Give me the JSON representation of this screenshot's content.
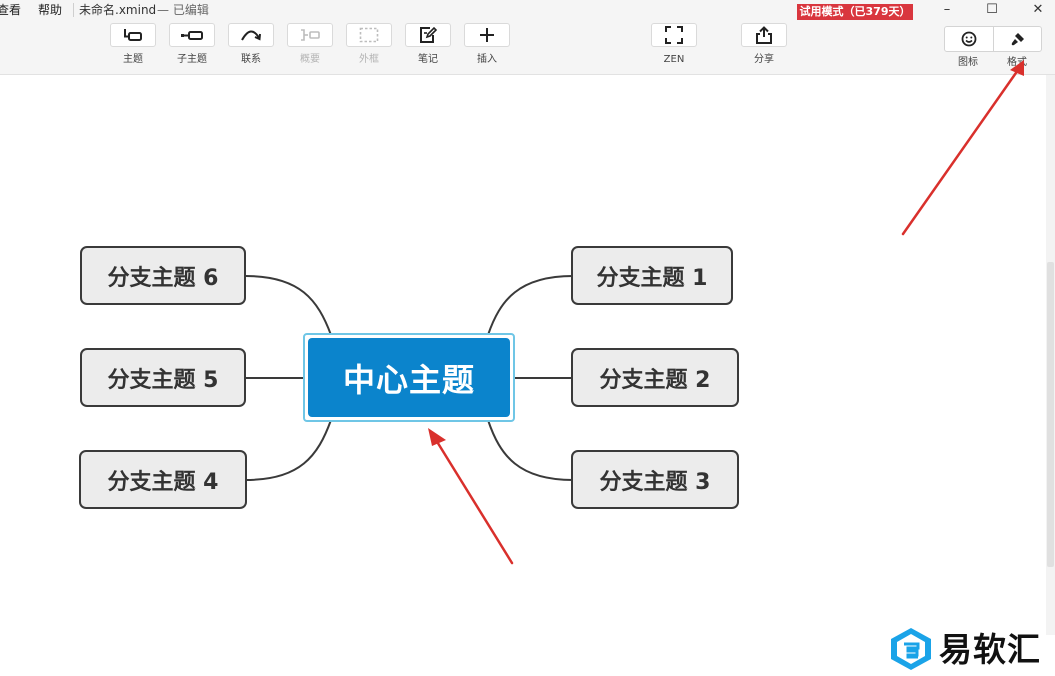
{
  "menu": {
    "view": "查看",
    "help": "帮助"
  },
  "document": {
    "title": "未命名.xmind",
    "status": "— 已编辑"
  },
  "trial_badge": "试用模式（已379天）",
  "window_controls": {
    "minimize": "–",
    "maximize": "☐",
    "close": "✕"
  },
  "toolbar": {
    "topic": "主题",
    "subtopic": "子主题",
    "relationship": "联系",
    "summary": "概要",
    "boundary": "外框",
    "note": "笔记",
    "insert": "插入",
    "zen": "ZEN",
    "share": "分享",
    "icon_panel": "图标",
    "format_panel": "格式"
  },
  "mindmap": {
    "central_topic": "中心主题",
    "branches": {
      "b1": "分支主题 1",
      "b2": "分支主题 2",
      "b3": "分支主题 3",
      "b4": "分支主题 4",
      "b5": "分支主题 5",
      "b6": "分支主题 6"
    }
  },
  "watermark": "易软汇",
  "colors": {
    "central_fill": "#0b84cc",
    "central_outline": "#6fc6e6",
    "branch_fill": "#ececec",
    "annotation_arrow": "#d9302c",
    "trial_badge": "#d9363e"
  }
}
